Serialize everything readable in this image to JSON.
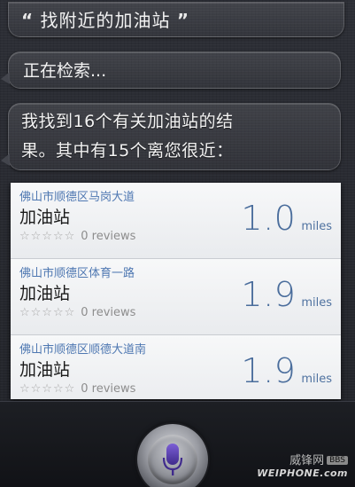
{
  "conversation": {
    "query_open_quote": "“",
    "query_text": "找附近的加油站",
    "query_close_quote": "”",
    "status_text": "正在检索...",
    "answer_line1": "我找到16个有关加油站的结",
    "answer_line2": "果。其中有15个离您很近："
  },
  "results": [
    {
      "address": "佛山市顺德区马岗大道",
      "name": "加油站",
      "stars": "☆☆☆☆☆",
      "reviews": "0 reviews",
      "distance_value": "1.0",
      "distance_unit": "miles"
    },
    {
      "address": "佛山市顺德区体育一路",
      "name": "加油站",
      "stars": "☆☆☆☆☆",
      "reviews": "0 reviews",
      "distance_value": "1.9",
      "distance_unit": "miles"
    },
    {
      "address": "佛山市顺德区顺德大道南",
      "name": "加油站",
      "stars": "☆☆☆☆☆",
      "reviews": "0 reviews",
      "distance_value": "1.9",
      "distance_unit": "miles"
    }
  ],
  "watermark": {
    "cn": "威锋网",
    "tag": "BBS",
    "en": "WEIPHONE.com"
  },
  "icons": {
    "mic": "microphone-icon"
  },
  "colors": {
    "mic_accent": "#5b3fb0",
    "address_blue": "#4f78b2",
    "distance_blue": "#4a6d9c"
  }
}
